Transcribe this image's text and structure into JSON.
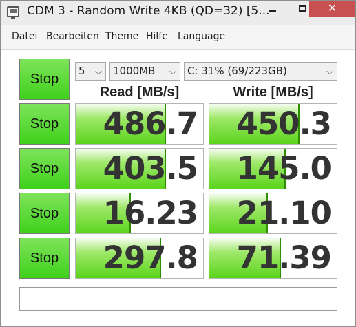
{
  "window": {
    "title": "CDM 3 - Random Write 4KB (QD=32) [5...",
    "controls": {
      "minimize": "–",
      "maximize": "□",
      "close": "✕"
    }
  },
  "menu": [
    "Datei",
    "Bearbeiten",
    "Theme",
    "Hilfe",
    "Language"
  ],
  "settings": {
    "count": "5",
    "size": "1000MB",
    "drive": "C: 31% (69/223GB)"
  },
  "headers": {
    "read": "Read [MB/s]",
    "write": "Write [MB/s]"
  },
  "stop_label": "Stop",
  "rows": [
    {
      "read": "486.7",
      "write": "450.3",
      "read_fill": 0.71,
      "write_fill": 0.71
    },
    {
      "read": "403.5",
      "write": "145.0",
      "read_fill": 0.71,
      "write_fill": 0.6
    },
    {
      "read": "16.23",
      "write": "21.10",
      "read_fill": 0.43,
      "write_fill": 0.46
    },
    {
      "read": "297.8",
      "write": "71.39",
      "read_fill": 0.67,
      "write_fill": 0.56
    }
  ],
  "colors": {
    "stop_green": "#4fd82a",
    "bar_green": "#5bd41c",
    "close_red": "#c75050"
  },
  "status_text": ""
}
